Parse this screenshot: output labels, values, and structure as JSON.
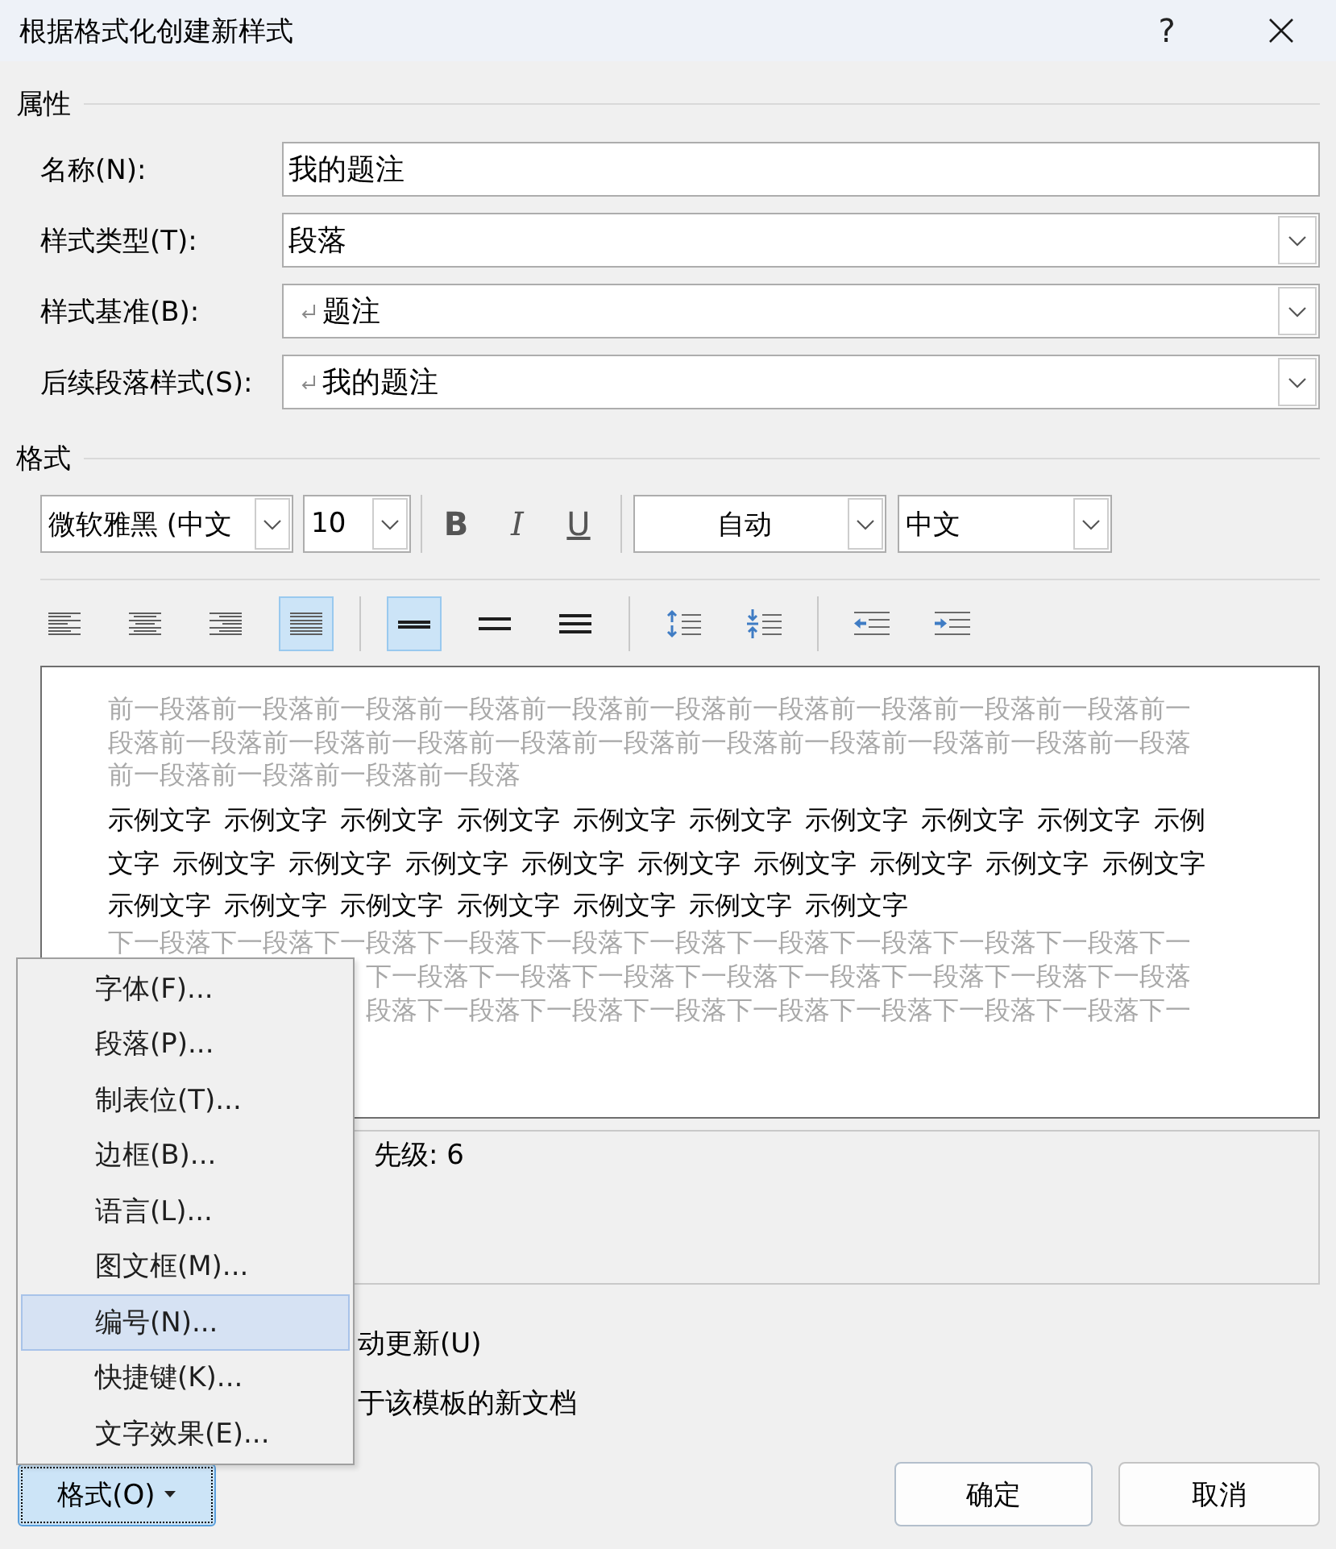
{
  "window": {
    "title": "根据格式化创建新样式",
    "help": "?"
  },
  "properties": {
    "heading": "属性",
    "fields": [
      {
        "label": "名称(N):",
        "kind": "text",
        "value": "我的题注",
        "paragraph_mark": false
      },
      {
        "label": "样式类型(T):",
        "kind": "dropdown",
        "value": "段落",
        "paragraph_mark": false
      },
      {
        "label": "样式基准(B):",
        "kind": "dropdown",
        "value": "题注",
        "paragraph_mark": true
      },
      {
        "label": "后续段落样式(S):",
        "kind": "dropdown",
        "value": "我的题注",
        "paragraph_mark": true
      }
    ]
  },
  "format": {
    "heading": "格式",
    "font": "微软雅黑 (中文",
    "size": "10",
    "style_buttons": [
      {
        "kind": "bold",
        "label": "B"
      },
      {
        "kind": "italic",
        "label": "I"
      },
      {
        "kind": "underline",
        "label": "U"
      }
    ],
    "fill_setting": "自动",
    "language": "中文",
    "alignment": [
      {
        "kind": "align_left",
        "selected": false
      },
      {
        "kind": "align_center",
        "selected": false
      },
      {
        "kind": "align_right",
        "selected": false
      },
      {
        "kind": "justify",
        "selected": true
      }
    ],
    "line_spacing": [
      {
        "kind": "single",
        "selected": true
      },
      {
        "kind": "one_and_half",
        "selected": false
      },
      {
        "kind": "double",
        "selected": false
      }
    ],
    "paragraph_spacing": [
      {
        "kind": "increase"
      },
      {
        "kind": "decrease"
      }
    ],
    "indent": [
      {
        "kind": "decrease"
      },
      {
        "kind": "increase"
      }
    ]
  },
  "preview": {
    "previous_paragraph": [
      "前一段落前一段落前一段落前一段落前一段落前一段落前一段落前一段落前一段落前一段落前一",
      "段落前一段落前一段落前一段落前一段落前一段落前一段落前一段落前一段落前一段落前一段落",
      "前一段落前一段落前一段落前一段落"
    ],
    "sample_text": [
      "示例文字 示例文字 示例文字 示例文字 示例文字 示例文字 示例文字 示例文字 示例文字 示例",
      "文字 示例文字 示例文字 示例文字 示例文字 示例文字 示例文字 示例文字 示例文字 示例文字",
      "示例文字 示例文字 示例文字 示例文字 示例文字 示例文字 示例文字"
    ],
    "next_paragraph": {
      "first_line": "下一段落下一段落下一段落下一段落下一段落下一段落下一段落下一段落下一段落下一段落下一",
      "covered_lines": [
        "下一段落下一段落下一段落下一段落下一段落下一段落下一段落下一段落",
        "段落下一段落下一段落下一段落下一段落下一段落下一段落下一段落下一"
      ]
    }
  },
  "description": "先级: 6",
  "options": [
    "动更新(U)",
    "于该模板的新文档"
  ],
  "format_menu": [
    {
      "label": "字体(F)...",
      "selected": false
    },
    {
      "label": "段落(P)...",
      "selected": false
    },
    {
      "label": "制表位(T)...",
      "selected": false
    },
    {
      "label": "边框(B)...",
      "selected": false
    },
    {
      "label": "语言(L)...",
      "selected": false
    },
    {
      "label": "图文框(M)...",
      "selected": false
    },
    {
      "label": "编号(N)...",
      "selected": true
    },
    {
      "label": "快捷键(K)...",
      "selected": false
    },
    {
      "label": "文字效果(E)...",
      "selected": false
    }
  ],
  "footer": {
    "format_button": {
      "label": "格式(O)",
      "expanded": true
    },
    "ok": "确定",
    "cancel": "取消"
  }
}
